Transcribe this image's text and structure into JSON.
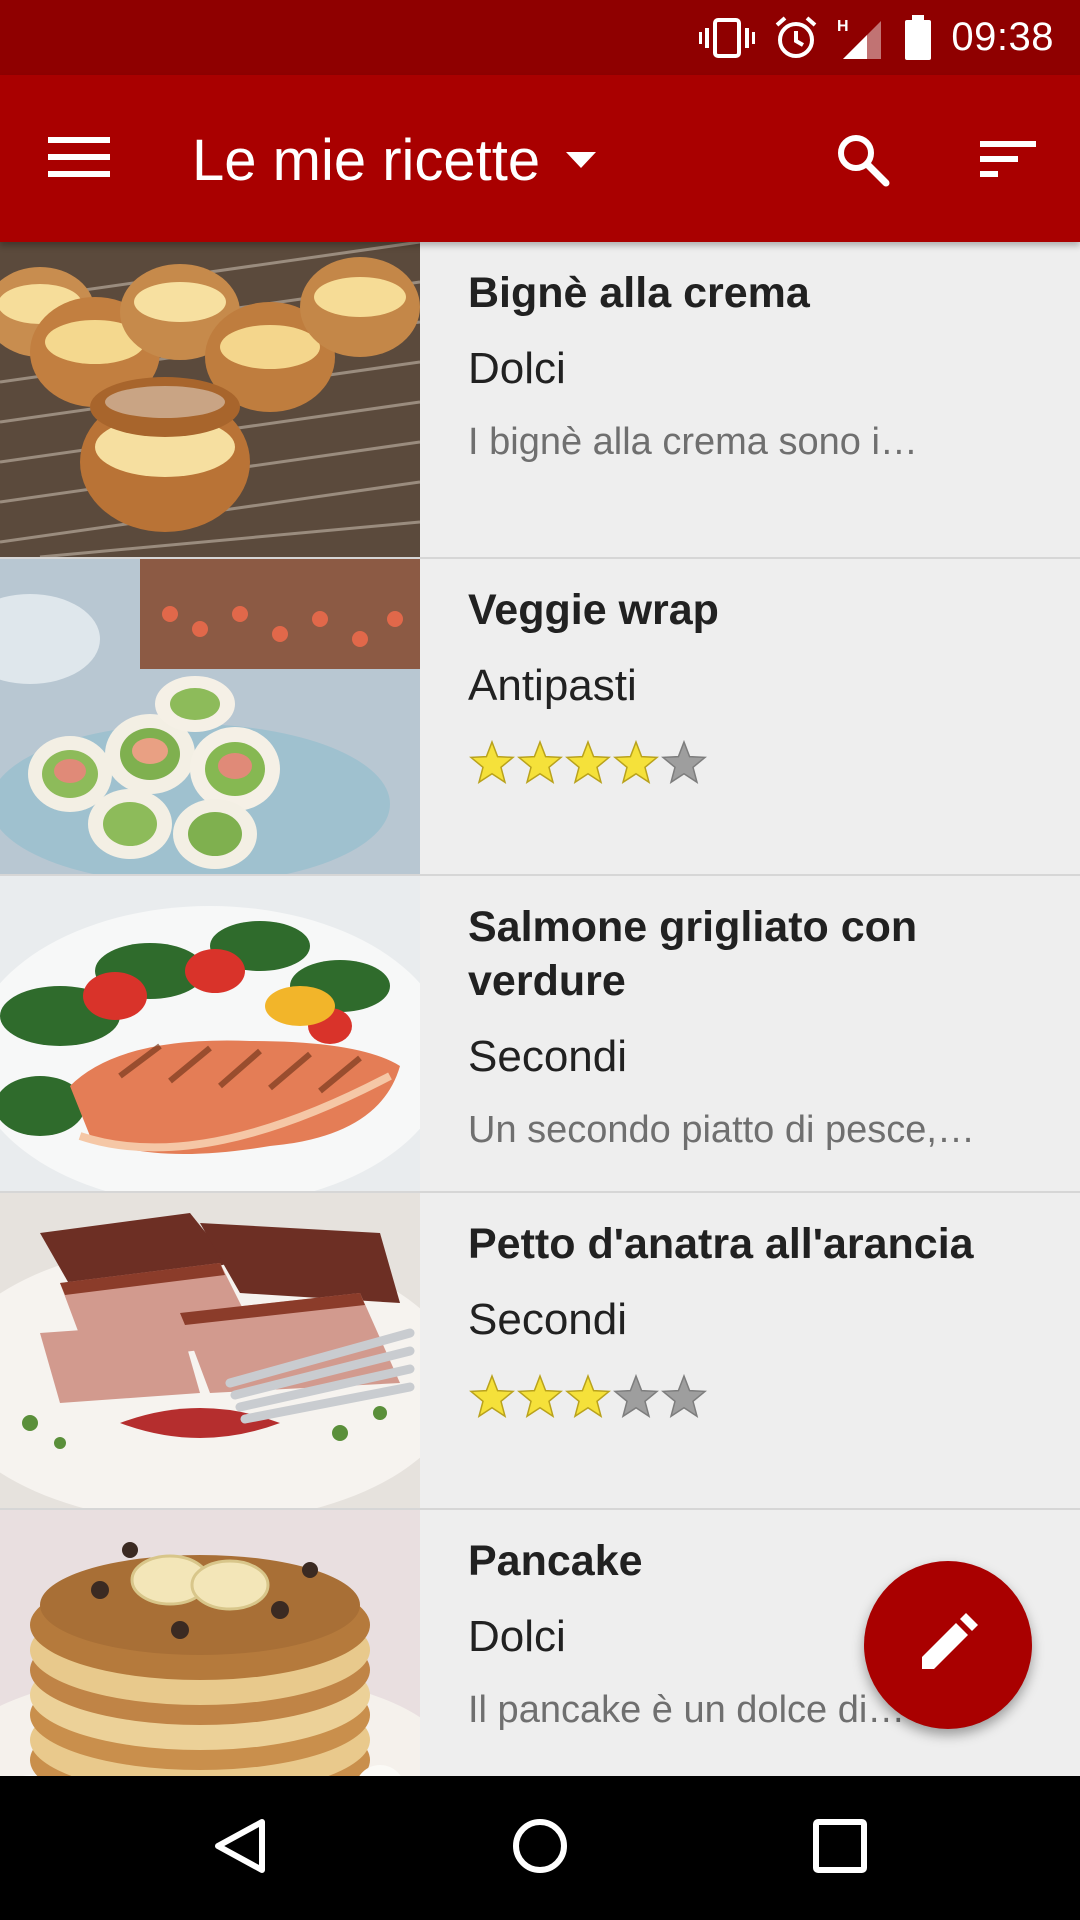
{
  "status_bar": {
    "time": "09:38",
    "icons": [
      "vibrate-icon",
      "alarm-icon",
      "signal-h-icon",
      "battery-icon"
    ]
  },
  "app_bar": {
    "title": "Le mie ricette",
    "icons": [
      "menu-icon",
      "dropdown-arrow-icon",
      "search-icon",
      "sort-icon"
    ],
    "color": "#a90000"
  },
  "recipes": [
    {
      "title": "Bignè alla crema",
      "category": "Dolci",
      "description": "I bignè alla crema sono i…",
      "rating": null
    },
    {
      "title": "Veggie wrap",
      "category": "Antipasti",
      "description": "",
      "rating": 4
    },
    {
      "title": "Salmone grigliato con verdure",
      "category": "Secondi",
      "description": "Un secondo piatto di pesce,…",
      "rating": null
    },
    {
      "title": "Petto d'anatra all'arancia",
      "category": "Secondi",
      "description": "",
      "rating": 3
    },
    {
      "title": "Pancake",
      "category": "Dolci",
      "description": "Il pancake è un dolce di…",
      "rating": null
    }
  ],
  "fab": {
    "icon": "pencil-icon"
  },
  "nav_bar": {
    "icons": [
      "back-icon",
      "home-icon",
      "recents-icon"
    ]
  },
  "colors": {
    "primary": "#a90000",
    "primary_dark": "#8f0000",
    "star_filled": "#f5e13a",
    "star_empty": "#9e9e9e"
  }
}
